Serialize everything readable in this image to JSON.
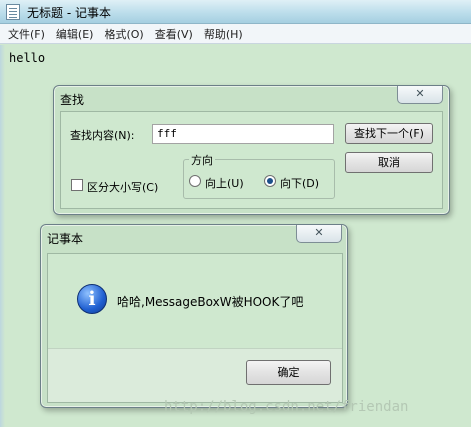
{
  "window": {
    "title": "无标题 - 记事本",
    "app_icon": "notepad-icon"
  },
  "menu": [
    "文件(F)",
    "编辑(E)",
    "格式(O)",
    "查看(V)",
    "帮助(H)"
  ],
  "editor": {
    "content": "hello"
  },
  "find_dialog": {
    "title": "查找",
    "close_glyph": "✕",
    "find_label": "查找内容(N):",
    "find_value": "fff",
    "find_next": "查找下一个(F)",
    "cancel": "取消",
    "match_case": "区分大小写(C)",
    "match_case_checked": false,
    "direction_title": "方向",
    "direction_up": "向上(U)",
    "direction_down": "向下(D)",
    "direction_selected": "down"
  },
  "message_box": {
    "title": "记事本",
    "close_glyph": "✕",
    "icon": "info-icon",
    "icon_glyph": "i",
    "message": "哈哈,MessageBoxW被HOOK了吧",
    "ok": "确定"
  },
  "watermark": "http://blog.csdn.net/friendan",
  "colors": {
    "background": "#cfe8cf",
    "accent": "#1f5fd1"
  }
}
